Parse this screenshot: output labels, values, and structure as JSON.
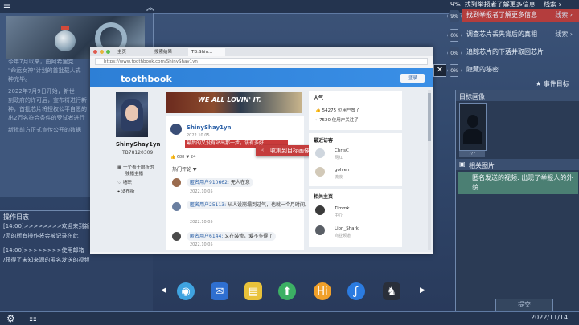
{
  "top_task": {
    "num": "9%",
    "text": "找到举报者了解更多信息",
    "clue": "线索 ›"
  },
  "tasks": [
    {
      "num": "9%",
      "text": "找到举报者了解更多信息",
      "clue": "线索 ›",
      "highlight": true
    },
    {
      "num": "0%",
      "text": "调查芯片丢失背后的真相",
      "clue": "线索 ›"
    },
    {
      "num": "0%",
      "text": "追踪芯片的下落并取回芯片",
      "clue": ""
    },
    {
      "num": "0%",
      "text": "隐藏的秘密",
      "clue": ""
    }
  ],
  "event_target": "事件目标",
  "target_panel": {
    "title": "目标画像",
    "portrait_label": "???",
    "related_title": "相关图片",
    "related_item": "匿名发送的视频: 出现了举报人的外貌"
  },
  "submit": "提交",
  "date": "2022/11/14",
  "doc": {
    "lines": [
      "今年7月以来，由阿希里克",
      "\"命运女神\"计划的首批载人式",
      "种完毕。",
      "",
      "2022年7月9日开始，新世",
      "刻政府的许可后，宣布将进行新",
      "种，首批芯片将授权公平自愿的",
      "出2万名符合条件的受试者进行",
      "",
      "新批前方正式宣传公开的数据"
    ]
  },
  "oplog": {
    "title": "操作日志",
    "entries": [
      "[14:00]>>>>>>>>欢迎来到新思",
      "/您的所有操作将会被记录在此",
      "",
      "[14:00]>>>>>>>>使用邮箱",
      "/获得了未知来源的匿名发送的视频"
    ]
  },
  "browser": {
    "tabs": [
      "主页",
      "搜索结果",
      "TB:Shin..."
    ],
    "url": "https://www.toothbook.com/ShinyShay1yn",
    "logo": "toothbook",
    "login": "登录",
    "user": {
      "name": "ShinyShay1yn",
      "id": "TB78120309",
      "info": [
        "一个善于眼析的",
        "独播主播",
        "墙职",
        "法布斯"
      ]
    },
    "banner_text": "WE ALL LOVIN' IT.",
    "post": {
      "author": "ShinyShay1yn",
      "date": "2022.10.05",
      "text": "最后的又没有站出那一步，该有多好",
      "likes": "👍 688  ♥ 24",
      "hot": "热门评论 ▼"
    },
    "comments": [
      {
        "user": "匿名用户910662:",
        "text": "无人在意",
        "date": "2022.10.05"
      },
      {
        "user": "匿名用户25113:",
        "text": "从人设崩塌到过气，也就一个月时间。",
        "date": "2022.10.05"
      },
      {
        "user": "匿名用户6144:",
        "text": "又在装惨，爱不多得了",
        "date": "2022.10.05"
      }
    ],
    "context_menu": "收集到目标画像",
    "popularity": {
      "title": "人气",
      "likes": "54275 位用户赞了",
      "followers": "7520 位用户关注了"
    },
    "visitors": {
      "title": "最近访客",
      "items": [
        {
          "name": "ChrisC",
          "sub": "网红"
        },
        {
          "name": "golven",
          "sub": "流浪"
        }
      ]
    },
    "related_hosts": {
      "title": "相关主页",
      "items": [
        {
          "name": "Timmk",
          "sub": "中介"
        },
        {
          "name": "Lion_Shark",
          "sub": "商业频道"
        }
      ]
    }
  },
  "colors": {
    "accent_red": "#c43d3d",
    "brand_blue": "#2d7fd6",
    "panel_bg": "#2b3b55"
  }
}
